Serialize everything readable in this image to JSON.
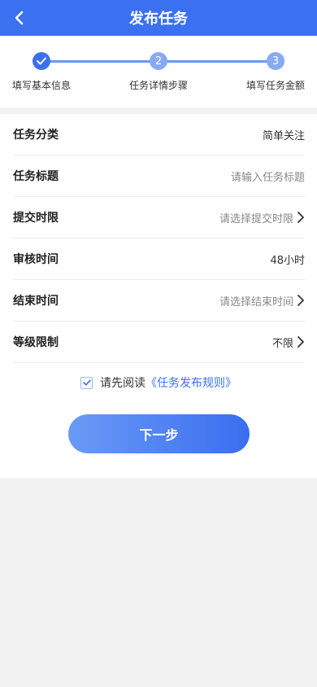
{
  "header": {
    "title": "发布任务"
  },
  "steps": [
    {
      "label": "填写基本信息",
      "number": "1",
      "status": "done"
    },
    {
      "label": "任务详情步骤",
      "number": "2",
      "status": "todo"
    },
    {
      "label": "填写任务金额",
      "number": "3",
      "status": "todo"
    }
  ],
  "form": {
    "rows": [
      {
        "label": "任务分类",
        "value": "简单关注",
        "placeholder": false,
        "chevron": false
      },
      {
        "label": "任务标题",
        "value": "请输入任务标题",
        "placeholder": true,
        "chevron": false
      },
      {
        "label": "提交时限",
        "value": "请选择提交时限",
        "placeholder": true,
        "chevron": true
      },
      {
        "label": "审核时间",
        "value": "48小时",
        "placeholder": false,
        "chevron": false
      },
      {
        "label": "结束时间",
        "value": "请选择结束时间",
        "placeholder": true,
        "chevron": true
      },
      {
        "label": "等级限制",
        "value": "不限",
        "placeholder": false,
        "chevron": true
      }
    ]
  },
  "agreement": {
    "checked": true,
    "prefix": "请先阅读",
    "link": "《任务发布规则》"
  },
  "actions": {
    "next_label": "下一步"
  },
  "colors": {
    "primary": "#3b71f0",
    "step_todo": "#88aaf2",
    "page_bg": "#f2f2f2"
  }
}
